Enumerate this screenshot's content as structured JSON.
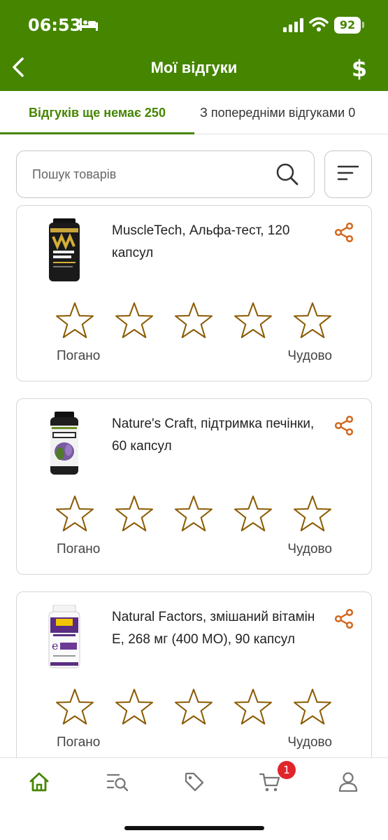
{
  "status_bar": {
    "time": "06:53",
    "battery": "92"
  },
  "header": {
    "title": "Мої відгуки",
    "back_icon": "chevron-left-icon",
    "right_icon": "dollar-icon",
    "right_label": "$",
    "background_color": "#458500"
  },
  "tabs": [
    {
      "label": "Відгуків ще немає 250",
      "active": true
    },
    {
      "label": "З попередніми відгуками 0",
      "active": false
    }
  ],
  "search": {
    "placeholder": "Пошук товарів",
    "value": ""
  },
  "products": [
    {
      "name": "MuscleTech, Альфа-тест, 120 капсул",
      "image_label": "ALPHA TEST",
      "brand_label": "MUSCLETECH",
      "rating_min_label": "Погано",
      "rating_max_label": "Чудово",
      "stars": 5
    },
    {
      "name": "Nature's Craft, підтримка печінки, 60 капсул",
      "image_label": "LIVER",
      "brand_label": "Nature's Craft",
      "rating_min_label": "Погано",
      "rating_max_label": "Чудово",
      "stars": 5
    },
    {
      "name": "Natural Factors, змішаний вітамін Е, 268 мг (400 МО), 90 капсул",
      "image_label": "e268mg",
      "brand_label": "Natural Factors",
      "rating_min_label": "Погано",
      "rating_max_label": "Чудово",
      "stars": 5
    }
  ],
  "bottom_nav": {
    "items": [
      "home-icon",
      "search-list-icon",
      "tag-icon",
      "cart-icon",
      "user-icon"
    ],
    "cart_badge": "1"
  },
  "colors": {
    "brand_green": "#458500",
    "star_outline": "#8a5a00",
    "share_orange": "#d2691e",
    "badge_red": "#e0262c"
  }
}
